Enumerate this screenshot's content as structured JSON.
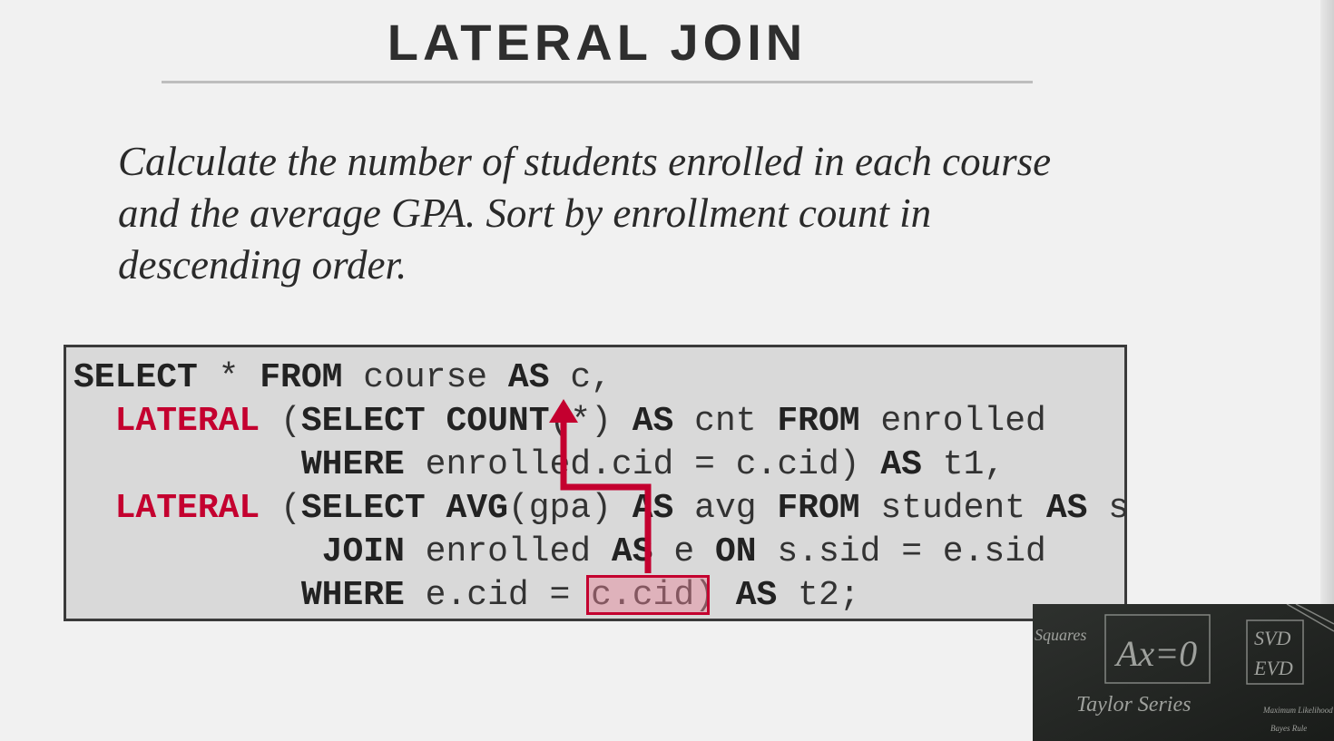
{
  "slide": {
    "title": "LATERAL JOIN",
    "prompt_lines": [
      "Calculate the number of students enrolled in each course",
      "and the average GPA. Sort by enrollment count in",
      "descending order."
    ]
  },
  "code": {
    "line1": {
      "kw1": "SELECT",
      "t1": " * ",
      "kw2": "FROM",
      "t2": " course ",
      "kw3": "AS",
      "t3": " c,"
    },
    "line2": {
      "indent": "  ",
      "lat": "LATERAL",
      "t1": " (",
      "kw1": "SELECT COUNT",
      "t2": "(*) ",
      "kw2": "AS",
      "t3": " cnt ",
      "kw3": "FROM",
      "t4": " enrolled"
    },
    "line3": {
      "indent": "           ",
      "kw1": "WHERE",
      "t1": " enrolled.cid = c.cid) ",
      "kw2": "AS",
      "t2": " t1,"
    },
    "line4": {
      "indent": "  ",
      "lat": "LATERAL",
      "t1": " (",
      "kw1": "SELECT AVG",
      "t2": "(gpa) ",
      "kw2": "AS",
      "t3": " avg ",
      "kw3": "FROM",
      "t4": " student ",
      "kw4": "AS",
      "t5": " s"
    },
    "line5": {
      "indent": "            ",
      "kw1": "JOIN",
      "t1": " enrolled ",
      "kw2": "AS",
      "t2": " e ",
      "kw3": "ON",
      "t3": " s.sid = e.sid"
    },
    "line6": {
      "indent": "           ",
      "kw1": "WHERE",
      "t1": " e.cid = c.cid) ",
      "kw2": "AS",
      "t2": " t2;"
    }
  },
  "video": {
    "chalk_text": [
      "Squares",
      "Ax=0",
      "SVD",
      "EVD",
      "Taylor Series",
      "Maximum Likelihood",
      "Bayes Rule"
    ]
  },
  "colors": {
    "accent": "#c4002f",
    "code_bg": "#d9d9d9",
    "slide_bg": "#f1f1f1"
  }
}
